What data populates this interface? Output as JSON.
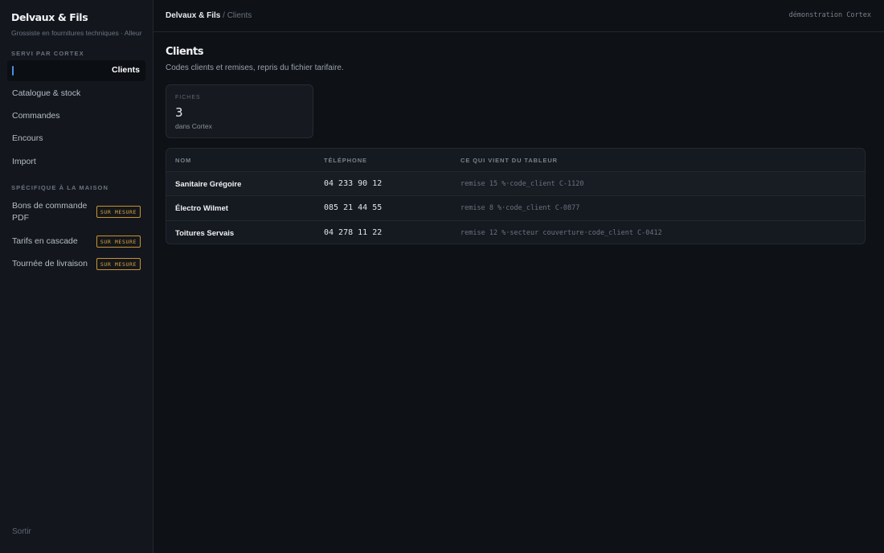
{
  "sidebar": {
    "brand_title": "Delvaux & Fils",
    "brand_subtitle": "Grossiste en fournitures techniques · Alleur",
    "section_cortex": "SERVI PAR CORTEX",
    "items_cortex": [
      {
        "label": "Clients",
        "active": true
      },
      {
        "label": "Catalogue & stock"
      },
      {
        "label": "Commandes"
      },
      {
        "label": "Encours"
      },
      {
        "label": "Import"
      }
    ],
    "section_maison": "SPÉCIFIQUE À LA MAISON",
    "items_maison": [
      {
        "label": "Bons de commande PDF",
        "badge": "SUR MESURE"
      },
      {
        "label": "Tarifs en cascade",
        "badge": "SUR MESURE"
      },
      {
        "label": "Tournée de livraison",
        "badge": "SUR MESURE"
      }
    ],
    "logout_label": "Sortir"
  },
  "topbar": {
    "breadcrumb_root": "Delvaux & Fils",
    "breadcrumb_sep": "/",
    "breadcrumb_current": "Clients",
    "demo_label": "démonstration Cortex"
  },
  "main": {
    "title": "Clients",
    "subtitle": "Codes clients et remises, repris du fichier tarifaire.",
    "stat": {
      "label": "FICHES",
      "value": "3",
      "note": "dans Cortex"
    },
    "table": {
      "headers": [
        "NOM",
        "TÉLÉPHONE",
        "CE QUI VIENT DU TABLEUR"
      ],
      "rows": [
        {
          "name": "Sanitaire Grégoire",
          "phone": "04 233 90 12",
          "extra": "remise 15 %·code_client C-1120"
        },
        {
          "name": "Électro Wilmet",
          "phone": "085 21 44 55",
          "extra": "remise 8 %·code_client C-0877"
        },
        {
          "name": "Toitures Servais",
          "phone": "04 278 11 22",
          "extra": "remise 12 %·secteur couverture·code_client C-0412"
        }
      ]
    }
  },
  "colors": {
    "accent": "#4a8fe0",
    "badge": "#d9a13a",
    "background": "#0e1116",
    "sidebar": "#13171d"
  }
}
